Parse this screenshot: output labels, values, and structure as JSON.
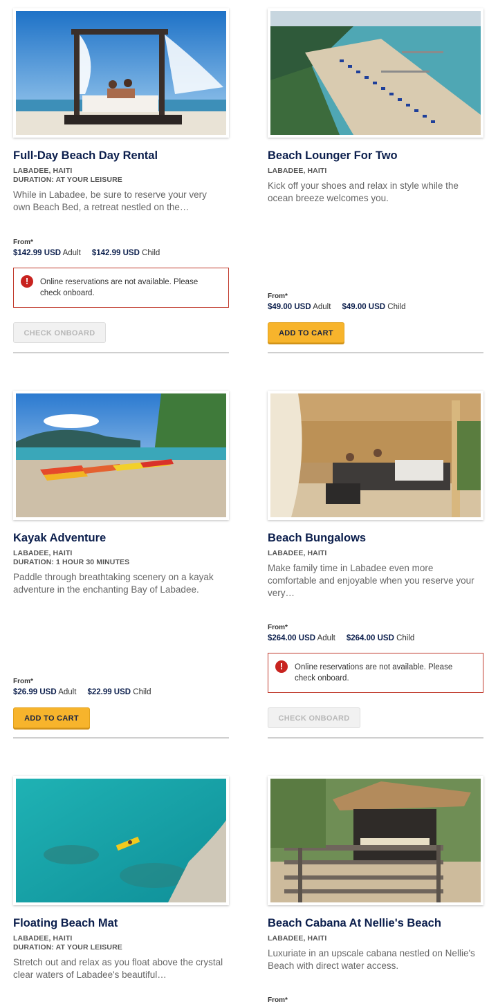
{
  "cards": [
    {
      "title": "Full-Day Beach Day Rental",
      "location": "LABADEE, HAITI",
      "duration": "DURATION: AT YOUR LEISURE",
      "description": "While in Labadee, be sure to reserve your very own Beach Bed, a retreat nestled on the…",
      "from_label": "From*",
      "adult_price": "$142.99 USD",
      "adult_label": "Adult",
      "child_price": "$142.99 USD",
      "child_label": "Child",
      "alert": "Online reservations are not available. Please check onboard.",
      "button": "CHECK ONBOARD"
    },
    {
      "title": "Beach Lounger For Two",
      "location": "LABADEE, HAITI",
      "description": "Kick off your shoes and relax in style while the ocean breeze welcomes you.",
      "from_label": "From*",
      "adult_price": "$49.00 USD",
      "adult_label": "Adult",
      "child_price": "$49.00 USD",
      "child_label": "Child",
      "button": "ADD TO CART"
    },
    {
      "title": "Kayak Adventure",
      "location": "LABADEE, HAITI",
      "duration": "DURATION: 1 HOUR 30 MINUTES",
      "description": "Paddle through breathtaking scenery on a kayak adventure in the enchanting Bay of Labadee.",
      "from_label": "From*",
      "adult_price": "$26.99 USD",
      "adult_label": "Adult",
      "child_price": "$22.99 USD",
      "child_label": "Child",
      "button": "ADD TO CART"
    },
    {
      "title": "Beach Bungalows",
      "location": "LABADEE, HAITI",
      "description": "Make family time in Labadee even more comfortable and enjoyable when you reserve your very…",
      "from_label": "From*",
      "adult_price": "$264.00 USD",
      "adult_label": "Adult",
      "child_price": "$264.00 USD",
      "child_label": "Child",
      "alert": "Online reservations are not available. Please check onboard.",
      "button": "CHECK ONBOARD"
    },
    {
      "title": "Floating Beach Mat",
      "location": "LABADEE, HAITI",
      "duration": "DURATION: AT YOUR LEISURE",
      "description": "Stretch out and relax as you float above the crystal clear waters of Labadee's beautiful…"
    },
    {
      "title": "Beach Cabana At Nellie's Beach",
      "location": "LABADEE, HAITI",
      "description": "Luxuriate in an upscale cabana nestled on Nellie's Beach with direct water access.",
      "from_label": "From*"
    }
  ],
  "alert_icon": "!",
  "colors": {
    "title": "#0b1e4c",
    "cart_button": "#f7b42c",
    "alert_border": "#c0392b",
    "alert_icon": "#c8231f"
  }
}
